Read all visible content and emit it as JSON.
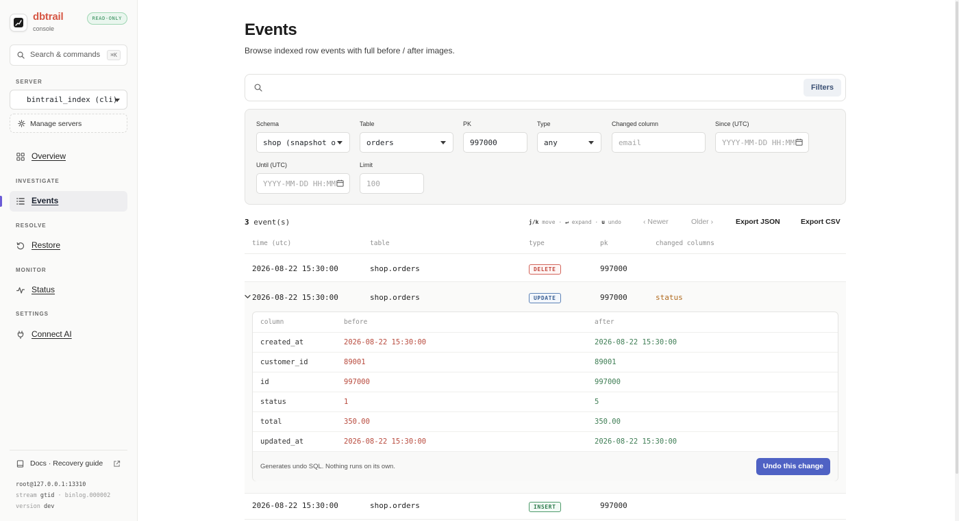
{
  "sidebar": {
    "brand_name": "dbtrail",
    "brand_sub": "console",
    "badge": "READ-ONLY",
    "search_label": "Search & commands",
    "search_kbd": "⌘K",
    "server_section": "SERVER",
    "server_value": "bintrail_index (cli)",
    "manage_label": "Manage servers",
    "overview": "Overview",
    "investigate_section": "INVESTIGATE",
    "events": "Events",
    "resolve_section": "RESOLVE",
    "restore": "Restore",
    "monitor_section": "MONITOR",
    "status": "Status",
    "settings_section": "SETTINGS",
    "connect_ai": "Connect AI",
    "docs": "Docs · Recovery guide",
    "footer": {
      "conn": "root@127.0.0.1:13310",
      "stream_label": "stream",
      "stream_value": "gtid",
      "stream_sep": "·",
      "binlog": "binlog.000002",
      "version_label": "version",
      "version_value": "dev"
    }
  },
  "main": {
    "title": "Events",
    "subtitle": "Browse indexed row events with full before / after images.",
    "search_placeholder": "",
    "filters_button": "Filters",
    "filters": {
      "schema_label": "Schema",
      "schema_value": "shop (snapshot o",
      "table_label": "Table",
      "table_value": "orders",
      "pk_label": "PK",
      "pk_value": "997000",
      "type_label": "Type",
      "type_value": "any",
      "changed_label": "Changed column",
      "changed_placeholder": "email",
      "since_label": "Since (UTC)",
      "since_placeholder": "YYYY-MM-DD HH:MM",
      "until_label": "Until (UTC)",
      "until_placeholder": "YYYY-MM-DD HH:MM",
      "limit_label": "Limit",
      "limit_placeholder": "100"
    },
    "results": {
      "count": "3",
      "count_suffix": "event(s)",
      "hint_move_key": "j/k",
      "hint_move": "move",
      "hint_expand_key": "↵",
      "hint_expand": "expand",
      "hint_undo_key": "u",
      "hint_undo": "undo",
      "hint_sep": "·",
      "newer": "‹ Newer",
      "older": "Older ›",
      "export_json": "Export JSON",
      "export_csv": "Export CSV"
    },
    "columns": [
      "time (utc)",
      "table",
      "type",
      "pk",
      "changed columns"
    ],
    "rows": [
      {
        "time": "2026-08-22 15:30:00",
        "table": "shop.orders",
        "type": "DELETE",
        "pk": "997000",
        "changed": ""
      },
      {
        "time": "2026-08-22 15:30:00",
        "table": "shop.orders",
        "type": "UPDATE",
        "pk": "997000",
        "changed": "status"
      },
      {
        "time": "2026-08-22 15:30:00",
        "table": "shop.orders",
        "type": "INSERT",
        "pk": "997000",
        "changed": ""
      }
    ],
    "diff": {
      "headers": [
        "column",
        "before",
        "after"
      ],
      "rows": [
        {
          "column": "created_at",
          "before": "2026-08-22 15:30:00",
          "after": "2026-08-22 15:30:00"
        },
        {
          "column": "customer_id",
          "before": "89001",
          "after": "89001"
        },
        {
          "column": "id",
          "before": "997000",
          "after": "997000"
        },
        {
          "column": "status",
          "before": "1",
          "after": "5"
        },
        {
          "column": "total",
          "before": "350.00",
          "after": "350.00"
        },
        {
          "column": "updated_at",
          "before": "2026-08-22 15:30:00",
          "after": "2026-08-22 15:30:00"
        }
      ],
      "note": "Generates undo SQL. Nothing runs on its own.",
      "undo_button": "Undo this change"
    }
  },
  "colors": {
    "brand": "#d65745",
    "accent": "#4f62c4",
    "delete": "#c24a40",
    "update": "#3a5f93",
    "insert": "#2d7a4c"
  }
}
